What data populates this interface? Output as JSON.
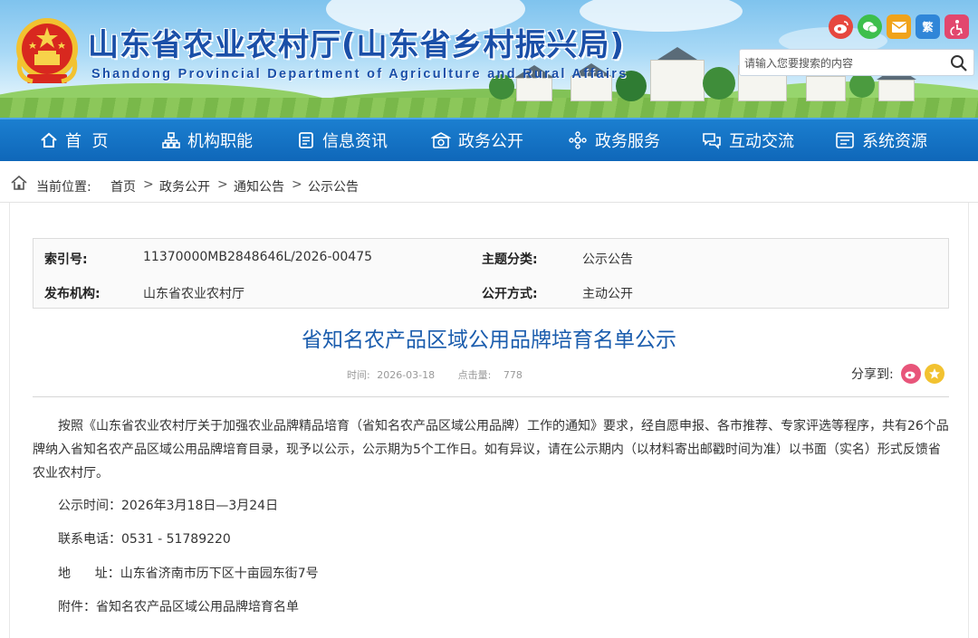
{
  "header": {
    "title": "山东省农业农村厅(山东省乡村振兴局)",
    "subtitle": "Shandong Provincial Department of Agriculture and Rural Affairs",
    "social": [
      {
        "name": "weibo-icon",
        "color": "#e6473f",
        "glyph": "微"
      },
      {
        "name": "wechat-icon",
        "color": "#3dbf4c",
        "glyph": "信"
      },
      {
        "name": "mail-icon",
        "color": "#f0a31a",
        "glyph": "✉"
      },
      {
        "name": "accessibility-text-icon",
        "color": "#2f86d8",
        "glyph": "繁"
      },
      {
        "name": "accessibility-icon",
        "color": "#e2476e",
        "glyph": "♿"
      }
    ],
    "search": {
      "placeholder": "请输入您要搜索的内容"
    }
  },
  "nav": {
    "items": [
      {
        "label": "首  页",
        "icon": "home-icon"
      },
      {
        "label": "机构职能",
        "icon": "org-icon"
      },
      {
        "label": "信息资讯",
        "icon": "news-icon"
      },
      {
        "label": "政务公开",
        "icon": "gov-open-icon"
      },
      {
        "label": "政务服务",
        "icon": "service-icon"
      },
      {
        "label": "互动交流",
        "icon": "interact-icon"
      },
      {
        "label": "系统资源",
        "icon": "system-icon"
      }
    ]
  },
  "breadcrumb": {
    "label": "当前位置:",
    "items": [
      "首页",
      "政务公开",
      "通知公告",
      "公示公告"
    ],
    "separator": ">"
  },
  "meta": {
    "index_label": "索引号:",
    "index_value": "11370000MB2848646L/2026-00475",
    "topic_label": "主题分类:",
    "topic_value": "公示公告",
    "publisher_label": "发布机构:",
    "publisher_value": "山东省农业农村厅",
    "mode_label": "公开方式:",
    "mode_value": "主动公开"
  },
  "article": {
    "title": "省知名农产品区域公用品牌培育名单公示",
    "time_label": "时间:",
    "time_value": "2026-03-18",
    "clicks_label": "点击量:",
    "clicks_value": "778",
    "share_label": "分享到:",
    "paragraph": "按照《山东省农业农村厅关于加强农业品牌精品培育（省知名农产品区域公用品牌）工作的通知》要求，经自愿申报、各市推荐、专家评选等程序，共有26个品牌纳入省知名农产品区域公用品牌培育目录，现予以公示，公示期为5个工作日。如有异议，请在公示期内（以材料寄出邮戳时间为准）以书面（实名）形式反馈省农业农村厅。",
    "period": "公示时间：2026年3月18日—3月24日",
    "phone": "联系电话：0531 - 51789220",
    "address_label": "地      址：",
    "address_value": "山东省济南市历下区十亩园东街7号",
    "attachment_label": "附件：",
    "attachment_value": "省知名农产品区域公用品牌培育名单"
  }
}
